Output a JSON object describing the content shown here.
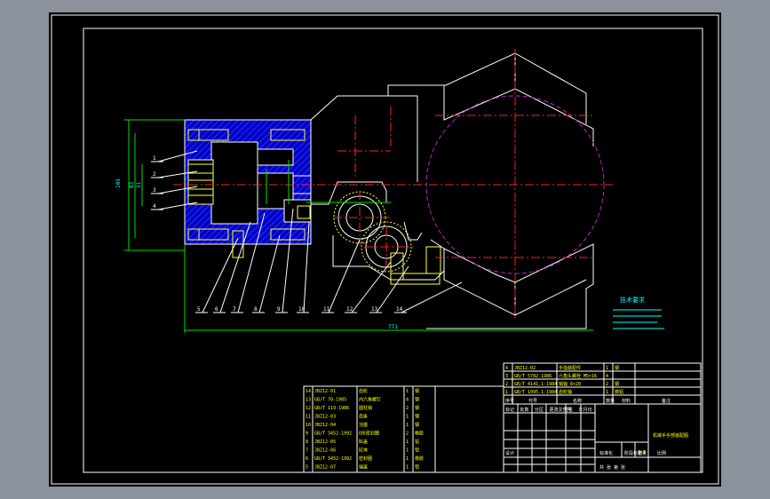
{
  "colors": {
    "background": "#8b929c",
    "sheet": "#000000",
    "outline": "#ffffff",
    "part_fill": "#0000c8",
    "hatch": "#5a5aff",
    "centerline": "#ff2020",
    "dimension": "#00d8ff",
    "leader": "#ffffff",
    "hidden_circle": "#c020c0",
    "title_text": "#ffff00",
    "bolt": "#ffff40",
    "green_line": "#00e000"
  },
  "annotations": {
    "overall_width": "771",
    "right_height": "105",
    "height_a": "83",
    "height_b": "31",
    "tech_req_title": "技术要求"
  },
  "leaders": [
    "1",
    "2",
    "3",
    "4",
    "5",
    "6",
    "7",
    "8",
    "9",
    "10",
    "11",
    "12",
    "13",
    "14"
  ],
  "upper_parts": [
    {
      "no": "4",
      "code": "JBZ12-02",
      "name": "手指装配件",
      "qty": "1",
      "note": "钢"
    },
    {
      "no": "3",
      "code": "GB/T 5782-1986",
      "name": "六角头螺栓 M5×16",
      "qty": "4",
      "note": ""
    },
    {
      "no": "2",
      "code": "GB/T 4141.1-1984",
      "name": "销轴 8×20",
      "qty": "2",
      "note": "钢"
    },
    {
      "no": "1",
      "code": "GB/T 1095.1-1984",
      "name": "齿轮轴",
      "qty": "1",
      "note": "铸铝"
    }
  ],
  "upper_header": [
    "序号",
    "代号",
    "名称",
    "数量",
    "材料",
    "备注"
  ],
  "lower_parts": [
    {
      "no": "14",
      "code": "JBZ12-01",
      "name": "齿轮",
      "qty": "1",
      "note": "钢"
    },
    {
      "no": "13",
      "code": "GB/T 70-1985",
      "name": "内六角螺钉",
      "qty": "4",
      "note": "钢"
    },
    {
      "no": "12",
      "code": "GB/T 119-1986",
      "name": "圆柱销",
      "qty": "2",
      "note": "钢"
    },
    {
      "no": "11",
      "code": "JBZ12-03",
      "name": "齿条",
      "qty": "1",
      "note": "钢"
    },
    {
      "no": "10",
      "code": "JBZ12-04",
      "name": "活塞",
      "qty": "1",
      "note": "钢"
    },
    {
      "no": "9",
      "code": "GB/T 3452-1992",
      "name": "O形密封圈",
      "qty": "2",
      "note": "橡胶"
    },
    {
      "no": "8",
      "code": "JBZ12-05",
      "name": "缸盖",
      "qty": "1",
      "note": "铝"
    },
    {
      "no": "7",
      "code": "JBZ12-06",
      "name": "缸体",
      "qty": "1",
      "note": "铝"
    },
    {
      "no": "6",
      "code": "GB/T 3452-1992",
      "name": "密封圈",
      "qty": "1",
      "note": "橡胶"
    },
    {
      "no": "5",
      "code": "JBZ12-07",
      "name": "端盖",
      "qty": "1",
      "note": "铝"
    }
  ],
  "title_block": {
    "drawing_title": "机械手手部装配图",
    "labels": [
      "标记",
      "处数",
      "分区",
      "更改文件号",
      "签名",
      "年月日"
    ],
    "design_row": [
      "设计",
      "标准化",
      "阶段标记",
      "重量",
      "比例"
    ],
    "scale": "1:1",
    "sheet_info": "共 张  第 张"
  }
}
